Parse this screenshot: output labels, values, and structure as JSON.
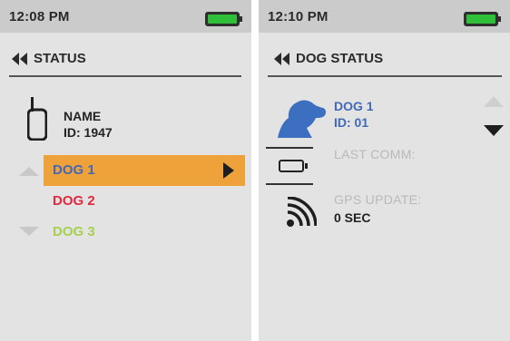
{
  "colors": {
    "screen_bg": "#e3e3e3",
    "status_bar_bg": "#cbcbcb",
    "battery_green": "#2fbf38",
    "selected_row": "#f0a23a",
    "dog1_blue": "#4169b8",
    "dog2_red": "#e0293e",
    "dog3_green": "#a6d04e",
    "disabled_grey": "#b9b9b9"
  },
  "left_screen": {
    "time": "12:08 PM",
    "battery_level": 1.0,
    "back_icon": "double-left-arrow-icon",
    "title": "STATUS",
    "device_icon": "handheld-device-icon",
    "name_label": "NAME",
    "id_label": "ID: 1947",
    "dogs": [
      {
        "label": "DOG 1",
        "color": "#4169b8",
        "selected": true
      },
      {
        "label": "DOG 2",
        "color": "#e0293e",
        "selected": false
      },
      {
        "label": "DOG 3",
        "color": "#a6d04e",
        "selected": false
      }
    ]
  },
  "right_screen": {
    "time": "12:10 PM",
    "battery_level": 1.0,
    "back_icon": "double-left-arrow-icon",
    "title": "DOG STATUS",
    "dog_icon": "dog-head-icon",
    "dog_name": "DOG 1",
    "dog_id": "ID: 01",
    "last_comm_label": "LAST COMM:",
    "collar_battery_icon": "battery-outline-icon",
    "gps_icon": "signal-waves-icon",
    "gps_update_label": "GPS UPDATE:",
    "gps_update_value": "0 SEC"
  }
}
